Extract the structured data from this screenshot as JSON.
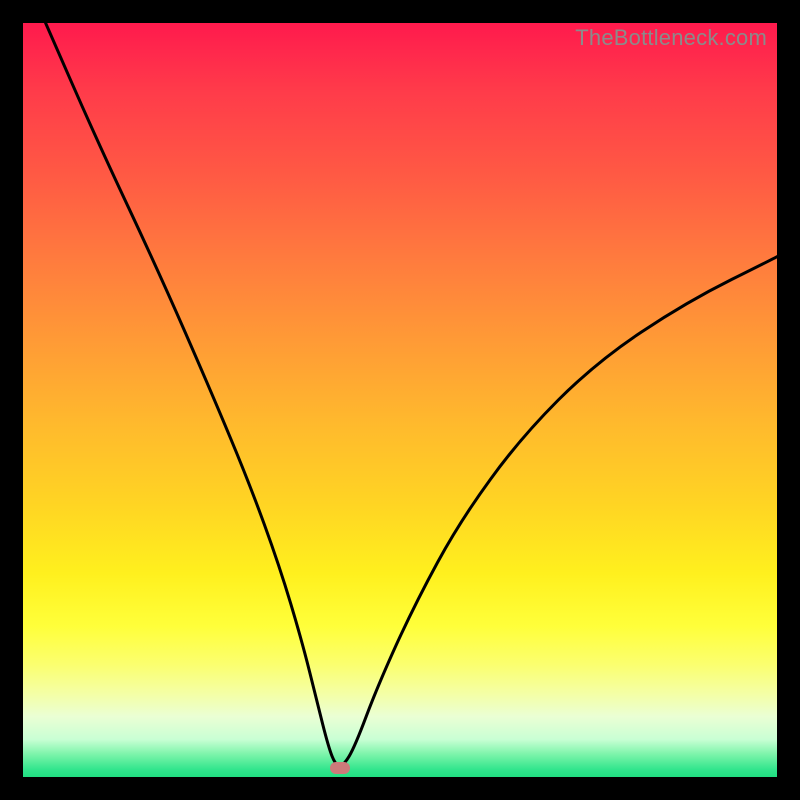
{
  "watermark": "TheBottleneck.com",
  "chart_data": {
    "type": "line",
    "title": "",
    "xlabel": "",
    "ylabel": "",
    "xlim": [
      0,
      100
    ],
    "ylim": [
      0,
      100
    ],
    "grid": false,
    "legend": false,
    "series": [
      {
        "name": "bottleneck-curve",
        "x": [
          3,
          10,
          18,
          25,
          30,
          34,
          37,
          39,
          40.5,
          41.5,
          42.5,
          44,
          47,
          52,
          58,
          66,
          76,
          88,
          100
        ],
        "values": [
          100,
          84,
          67,
          51,
          39,
          28,
          18,
          10,
          4,
          1.5,
          1.5,
          4,
          12,
          23,
          34,
          45,
          55,
          63,
          69
        ]
      }
    ],
    "marker": {
      "x": 42,
      "y": 1.2,
      "color": "#cc7a7a"
    },
    "gradient_stops": [
      {
        "pos": 0,
        "color": "#ff1a4d"
      },
      {
        "pos": 50,
        "color": "#ffb92d"
      },
      {
        "pos": 80,
        "color": "#ffff3a"
      },
      {
        "pos": 100,
        "color": "#20df81"
      }
    ]
  }
}
